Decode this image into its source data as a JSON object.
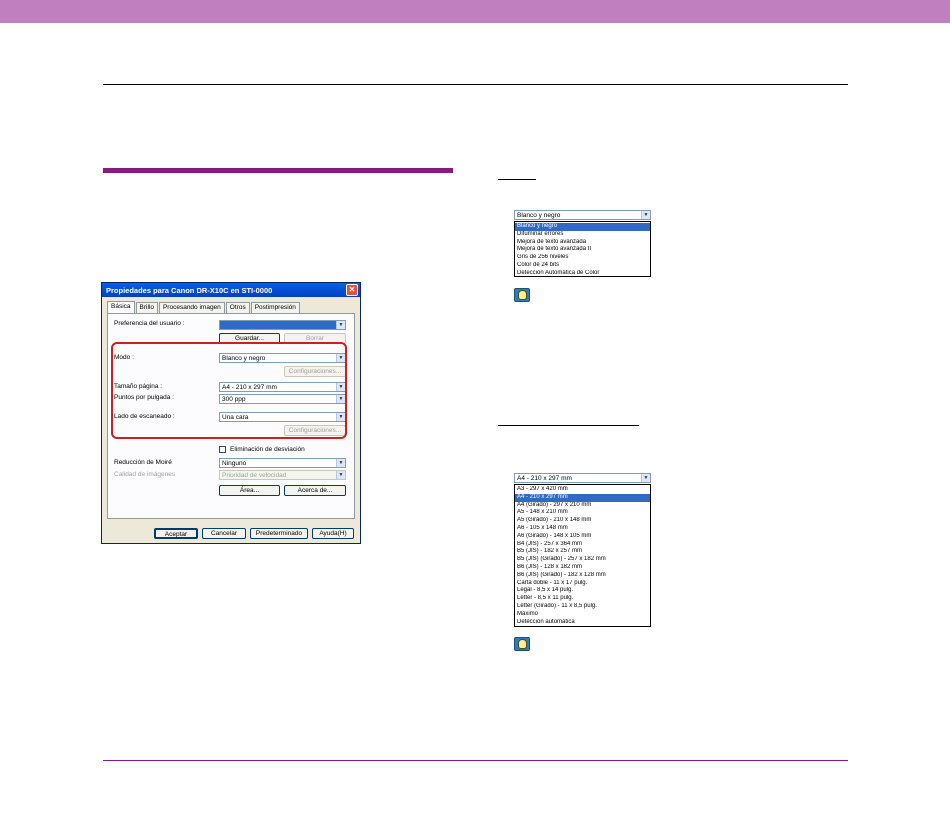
{
  "colors": {
    "top_band": "#c080c0",
    "section_bar": "#8a1a82",
    "bottom_rule": "#8a1a82",
    "highlight": "#cc2020"
  },
  "dialog": {
    "title": "Propiedades para Canon DR-X10C en STI-0000",
    "tabs": [
      "Básica",
      "Brillo",
      "Procesando imagen",
      "Otros",
      "Postimpresión"
    ],
    "user_pref_label": "Preferencia del usuario :",
    "save_button": "Guardar...",
    "delete_button": "Borrar",
    "mode_label": "Modo :",
    "mode_value": "Blanco y negro",
    "settings_button_1": "Configuraciones...",
    "page_size_label": "Tamaño página :",
    "page_size_value": "A4 - 210 x 297 mm",
    "dpi_label": "Puntos por pulgada :",
    "dpi_value": "300 ppp",
    "scan_side_label": "Lado de escaneado :",
    "scan_side_value": "Una cara",
    "settings_button_2": "Configuraciones...",
    "deskew_label": "Eliminación de desviación",
    "moire_label": "Reducción de Moiré",
    "moire_value": "Ninguno",
    "image_quality_label": "Calidad de imágenes",
    "image_quality_value": "Prioridad de velocidad",
    "area_button": "Área...",
    "about_button": "Acerca de...",
    "accept_button": "Aceptar",
    "cancel_button": "Cancelar",
    "default_button": "Predeterminado",
    "help_button": "Ayuda(H)"
  },
  "mode_dropdown": {
    "selected": "Blanco y negro",
    "options": [
      "Blanco y negro",
      "Difuminar errores",
      "Mejora de texto avanzada",
      "Mejora de texto avanzada II",
      "Gris de 256 niveles",
      "Color de 24 bits",
      "Detección Automática de Color"
    ],
    "highlighted_index": 0
  },
  "page_size_dropdown": {
    "selected": "A4 - 210 x 297 mm",
    "options": [
      "A3 - 297 x 420 mm",
      "A4 - 210 x 297 mm",
      "A4 (Girado) - 297 x 210 mm",
      "A5 - 148 x 210 mm",
      "A5 (Girado) - 210 x 148 mm",
      "A6 - 105 x 148 mm",
      "A6 (Girado) - 148 x 105 mm",
      "B4 (JIS) - 257 x 364 mm",
      "B5 (JIS) - 182 x 257 mm",
      "B5 (JIS) (Girado) - 257 x 182 mm",
      "B6 (JIS) - 128 x 182 mm",
      "B6 (JIS) (Girado) - 182 x 128 mm",
      "Carta doble - 11 x 17 pulg.",
      "Legal - 8,5 x 14 pulg.",
      "Letter - 8,5 x 11 pulg.",
      "Letter (Girado) - 11 x 8,5 pulg.",
      "Máximo",
      "Detección automática"
    ],
    "highlighted_index": 1
  }
}
